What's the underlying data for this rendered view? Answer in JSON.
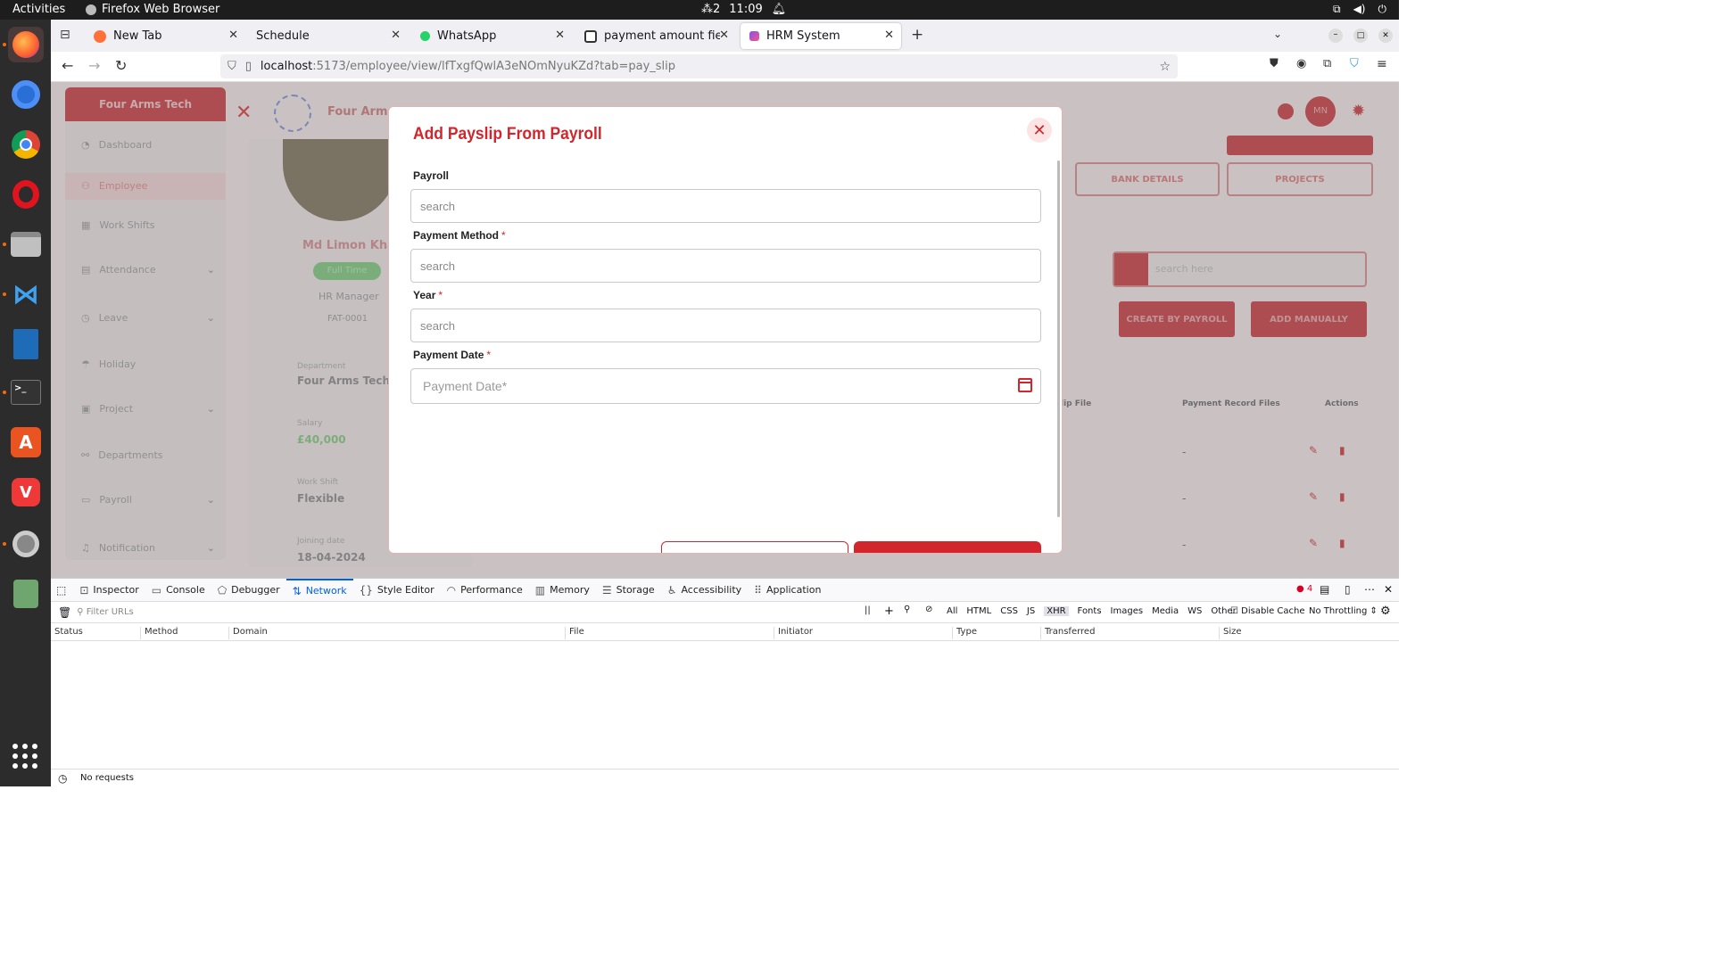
{
  "system_bar": {
    "activities": "Activities",
    "app_name": "Firefox Web Browser",
    "workspace": "2",
    "time": "11:09"
  },
  "browser": {
    "tabs": [
      {
        "title": "New Tab"
      },
      {
        "title": "Schedule"
      },
      {
        "title": "WhatsApp"
      },
      {
        "title": "payment amount field is"
      },
      {
        "title": "HRM System"
      }
    ],
    "url_host": "localhost",
    "url_path": ":5173/employee/view/lfTxgfQwlA3eNOmNyuKZd?tab=pay_slip"
  },
  "background_app": {
    "brand": "Four Arms Tech",
    "brand_header": "Four Arms",
    "sidebar": [
      {
        "label": "Dashboard"
      },
      {
        "label": "Employee"
      },
      {
        "label": "Work Shifts"
      },
      {
        "label": "Attendance"
      },
      {
        "label": "Leave"
      },
      {
        "label": "Holiday"
      },
      {
        "label": "Project"
      },
      {
        "label": "Departments"
      },
      {
        "label": "Payroll"
      },
      {
        "label": "Notification"
      }
    ],
    "profile": {
      "name": "Md Limon Khan",
      "employment": "Full Time",
      "role": "HR Manager",
      "code": "FAT-0001",
      "department_label": "Department",
      "department": "Four Arms Tech",
      "salary_label": "Salary",
      "salary": "£40,000",
      "shift_label": "Work Shift",
      "shift": "Flexible",
      "joining_label": "Joining date",
      "joining": "18-04-2024"
    },
    "tabs": {
      "bank": "BANK DETAILS",
      "projects": "PROJECTS"
    },
    "search_placeholder": "search here",
    "create_by_payroll": "CREATE BY PAYROLL",
    "add_manually": "ADD MANUALLY",
    "avatar_initials": "MN",
    "table_headers": {
      "slip": "lip File",
      "record": "Payment Record Files",
      "actions": "Actions"
    },
    "row_dash": "-"
  },
  "modal": {
    "title": "Add Payslip From Payroll",
    "fields": {
      "payroll": {
        "label": "Payroll",
        "placeholder": "search"
      },
      "method": {
        "label": "Payment Method",
        "placeholder": "search",
        "required": "*"
      },
      "year": {
        "label": "Year",
        "placeholder": "search",
        "required": "*"
      },
      "date": {
        "label": "Payment Date",
        "placeholder": "Payment Date*",
        "required": "*"
      }
    }
  },
  "devtools": {
    "tabs": [
      "Inspector",
      "Console",
      "Debugger",
      "Network",
      "Style Editor",
      "Performance",
      "Memory",
      "Storage",
      "Accessibility",
      "Application"
    ],
    "error_count": "4",
    "filter_placeholder": "Filter URLs",
    "types": [
      "All",
      "HTML",
      "CSS",
      "JS",
      "XHR",
      "Fonts",
      "Images",
      "Media",
      "WS",
      "Other"
    ],
    "disable_cache": "Disable Cache",
    "throttling": "No Throttling",
    "columns": [
      "Status",
      "Method",
      "Domain",
      "File",
      "Initiator",
      "Type",
      "Transferred",
      "Size"
    ],
    "status_text": "No requests"
  },
  "colors": {
    "accent": "#d1262c",
    "devtools_selected": "#0061e0"
  }
}
